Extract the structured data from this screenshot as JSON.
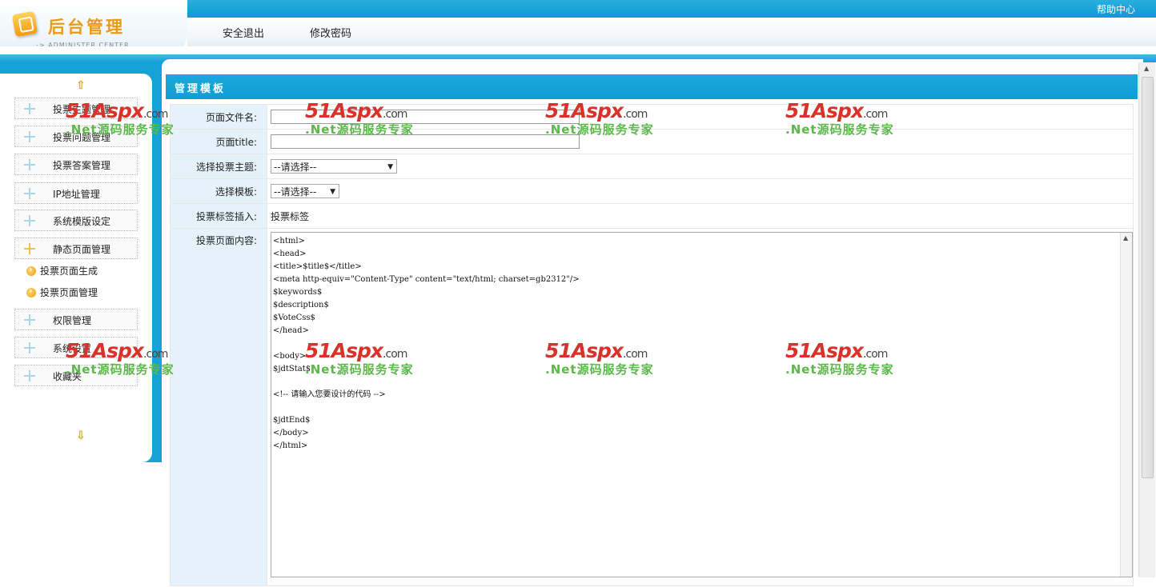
{
  "header": {
    "logo_title": "后台管理",
    "logo_subtitle": "-> ADMINISTER CENTER",
    "nav": [
      "安全退出",
      "修改密码"
    ],
    "help": "帮助中心"
  },
  "sidebar": {
    "up_arrow": "⇧",
    "down_arrow": "⇩",
    "items": [
      {
        "label": "投票主题管理"
      },
      {
        "label": "投票问题管理"
      },
      {
        "label": "投票答案管理"
      },
      {
        "label": "IP地址管理"
      },
      {
        "label": "系统模版设定"
      },
      {
        "label": "静态页面管理",
        "expanded": true
      }
    ],
    "subitems": [
      {
        "label": "投票页面生成"
      },
      {
        "label": "投票页面管理"
      }
    ],
    "items_after": [
      {
        "label": "权限管理"
      },
      {
        "label": "系统设置"
      },
      {
        "label": "收藏夹"
      }
    ]
  },
  "main": {
    "title": "管理模板",
    "form": {
      "file_name_label": "页面文件名:",
      "file_name_value": "",
      "page_title_label": "页面title:",
      "page_title_value": "",
      "topic_label": "选择投票主题:",
      "topic_selected": "--请选择--",
      "template_label": "选择模板:",
      "template_selected": "--请选择--",
      "tag_label": "投票标签插入:",
      "tag_value": "投票标签",
      "content_label": "投票页面内容:",
      "content_lines": [
        "<html>",
        "<head>",
        "<title>$title$</title>",
        "<meta http-equiv=\"Content-Type\" content=\"text/html; charset=gb2312\"/>",
        "$keywords$",
        "$description$",
        "$VoteCss$",
        "</head>",
        "",
        "<body>",
        "$jdtStat$",
        "",
        "<!-- 请输入您要设计的代码 -->",
        "",
        "$jdtEnd$",
        "</body>",
        "</html>"
      ]
    }
  },
  "watermark": {
    "brand": "51Aspx",
    "domain": ".com",
    "slogan": ".Net源码服务专家"
  }
}
